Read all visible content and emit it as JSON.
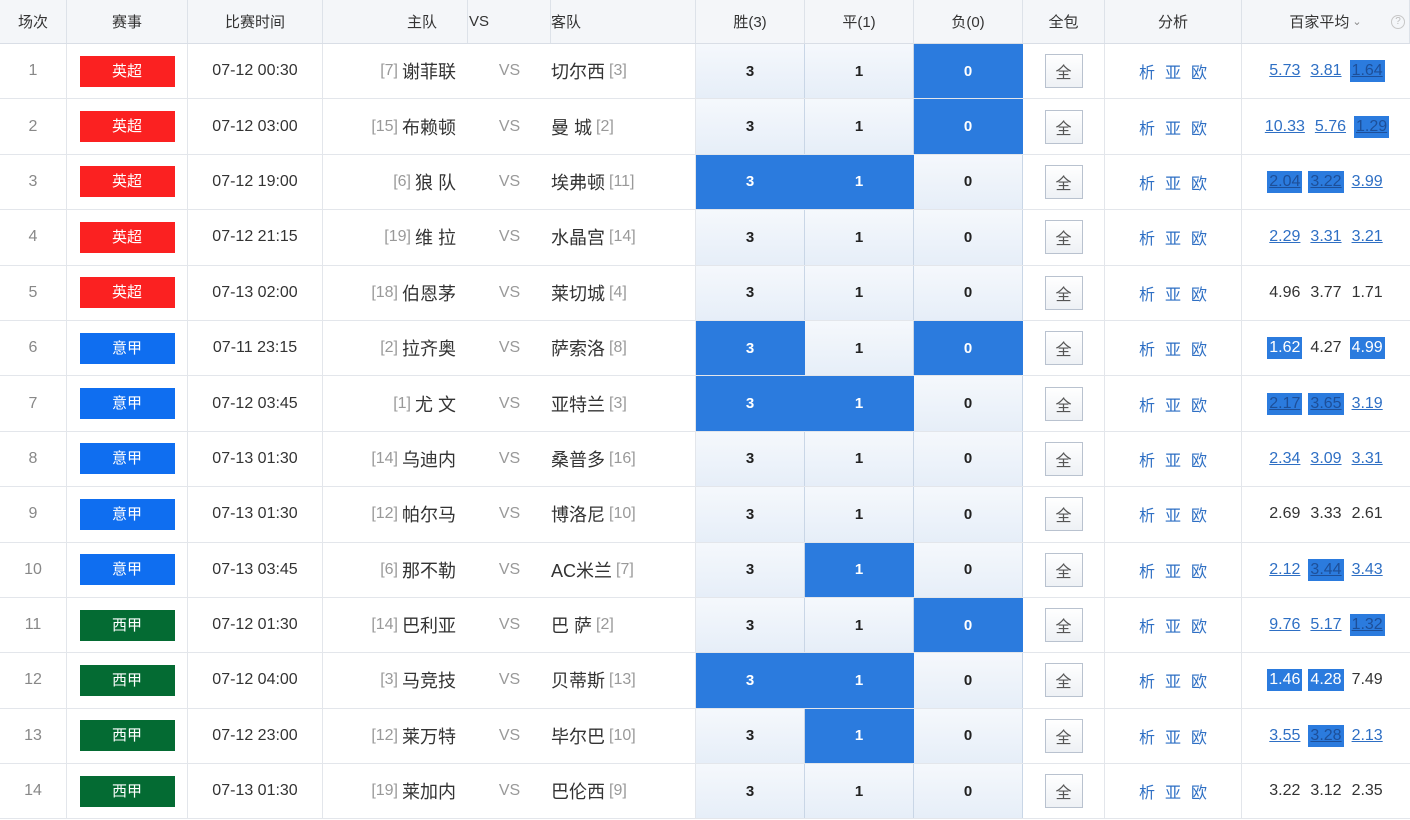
{
  "headers": {
    "idx": "场次",
    "league": "赛事",
    "time": "比赛时间",
    "home": "主队",
    "vs": "VS",
    "away": "客队",
    "win": "胜(3)",
    "draw": "平(1)",
    "loss": "负(0)",
    "all": "全包",
    "analysis": "分析",
    "avg": "百家平均"
  },
  "colors": {
    "epl": "#fb2121",
    "seriea": "#0f6ef0",
    "laliga": "#046b33",
    "selected": "#2b7bde",
    "link": "#2e6fc4"
  },
  "icons": {
    "sort": "chevron-down-icon",
    "help": "question-icon"
  },
  "labels": {
    "all_btn": "全",
    "ana1": "析",
    "ana2": "亚",
    "ana3": "欧"
  },
  "rows": [
    {
      "idx": "1",
      "league": "英超",
      "color": "#fb2121",
      "time": "07-12 00:30",
      "home_rank": "[7]",
      "home": "谢菲联",
      "vs": "VS",
      "away": "切尔西",
      "away_rank": "[3]",
      "win": "3",
      "draw": "1",
      "loss": "0",
      "sel": [
        false,
        false,
        true
      ],
      "odds": [
        {
          "v": "5.73",
          "link": true,
          "hl": false
        },
        {
          "v": "3.81",
          "link": true,
          "hl": false
        },
        {
          "v": "1.64",
          "link": true,
          "hl": true
        }
      ]
    },
    {
      "idx": "2",
      "league": "英超",
      "color": "#fb2121",
      "time": "07-12 03:00",
      "home_rank": "[15]",
      "home": "布赖顿",
      "vs": "VS",
      "away": "曼 城",
      "away_rank": "[2]",
      "win": "3",
      "draw": "1",
      "loss": "0",
      "sel": [
        false,
        false,
        true
      ],
      "odds": [
        {
          "v": "10.33",
          "link": true,
          "hl": false
        },
        {
          "v": "5.76",
          "link": true,
          "hl": false
        },
        {
          "v": "1.29",
          "link": true,
          "hl": true
        }
      ]
    },
    {
      "idx": "3",
      "league": "英超",
      "color": "#fb2121",
      "time": "07-12 19:00",
      "home_rank": "[6]",
      "home": "狼 队",
      "vs": "VS",
      "away": "埃弗顿",
      "away_rank": "[11]",
      "win": "3",
      "draw": "1",
      "loss": "0",
      "sel": [
        true,
        true,
        false
      ],
      "odds": [
        {
          "v": "2.04",
          "link": true,
          "hl": true
        },
        {
          "v": "3.22",
          "link": true,
          "hl": true
        },
        {
          "v": "3.99",
          "link": true,
          "hl": false
        }
      ]
    },
    {
      "idx": "4",
      "league": "英超",
      "color": "#fb2121",
      "time": "07-12 21:15",
      "home_rank": "[19]",
      "home": "维 拉",
      "vs": "VS",
      "away": "水晶宫",
      "away_rank": "[14]",
      "win": "3",
      "draw": "1",
      "loss": "0",
      "sel": [
        false,
        false,
        false
      ],
      "odds": [
        {
          "v": "2.29",
          "link": true,
          "hl": false
        },
        {
          "v": "3.31",
          "link": true,
          "hl": false
        },
        {
          "v": "3.21",
          "link": true,
          "hl": false
        }
      ]
    },
    {
      "idx": "5",
      "league": "英超",
      "color": "#fb2121",
      "time": "07-13 02:00",
      "home_rank": "[18]",
      "home": "伯恩茅",
      "vs": "VS",
      "away": "莱切城",
      "away_rank": "[4]",
      "win": "3",
      "draw": "1",
      "loss": "0",
      "sel": [
        false,
        false,
        false
      ],
      "odds": [
        {
          "v": "4.96",
          "link": false,
          "hl": false
        },
        {
          "v": "3.77",
          "link": false,
          "hl": false
        },
        {
          "v": "1.71",
          "link": false,
          "hl": false
        }
      ]
    },
    {
      "idx": "6",
      "league": "意甲",
      "color": "#0f6ef0",
      "time": "07-11 23:15",
      "home_rank": "[2]",
      "home": "拉齐奥",
      "vs": "VS",
      "away": "萨索洛",
      "away_rank": "[8]",
      "win": "3",
      "draw": "1",
      "loss": "0",
      "sel": [
        true,
        false,
        true
      ],
      "odds": [
        {
          "v": "1.62",
          "link": false,
          "hl": true
        },
        {
          "v": "4.27",
          "link": false,
          "hl": false
        },
        {
          "v": "4.99",
          "link": false,
          "hl": true
        }
      ]
    },
    {
      "idx": "7",
      "league": "意甲",
      "color": "#0f6ef0",
      "time": "07-12 03:45",
      "home_rank": "[1]",
      "home": "尤 文",
      "vs": "VS",
      "away": "亚特兰",
      "away_rank": "[3]",
      "win": "3",
      "draw": "1",
      "loss": "0",
      "sel": [
        true,
        true,
        false
      ],
      "odds": [
        {
          "v": "2.17",
          "link": true,
          "hl": true
        },
        {
          "v": "3.65",
          "link": true,
          "hl": true
        },
        {
          "v": "3.19",
          "link": true,
          "hl": false
        }
      ]
    },
    {
      "idx": "8",
      "league": "意甲",
      "color": "#0f6ef0",
      "time": "07-13 01:30",
      "home_rank": "[14]",
      "home": "乌迪内",
      "vs": "VS",
      "away": "桑普多",
      "away_rank": "[16]",
      "win": "3",
      "draw": "1",
      "loss": "0",
      "sel": [
        false,
        false,
        false
      ],
      "odds": [
        {
          "v": "2.34",
          "link": true,
          "hl": false
        },
        {
          "v": "3.09",
          "link": true,
          "hl": false
        },
        {
          "v": "3.31",
          "link": true,
          "hl": false
        }
      ]
    },
    {
      "idx": "9",
      "league": "意甲",
      "color": "#0f6ef0",
      "time": "07-13 01:30",
      "home_rank": "[12]",
      "home": "帕尔马",
      "vs": "VS",
      "away": "博洛尼",
      "away_rank": "[10]",
      "win": "3",
      "draw": "1",
      "loss": "0",
      "sel": [
        false,
        false,
        false
      ],
      "odds": [
        {
          "v": "2.69",
          "link": false,
          "hl": false
        },
        {
          "v": "3.33",
          "link": false,
          "hl": false
        },
        {
          "v": "2.61",
          "link": false,
          "hl": false
        }
      ]
    },
    {
      "idx": "10",
      "league": "意甲",
      "color": "#0f6ef0",
      "time": "07-13 03:45",
      "home_rank": "[6]",
      "home": "那不勒",
      "vs": "VS",
      "away": "AC米兰",
      "away_rank": "[7]",
      "win": "3",
      "draw": "1",
      "loss": "0",
      "sel": [
        false,
        true,
        false
      ],
      "odds": [
        {
          "v": "2.12",
          "link": true,
          "hl": false
        },
        {
          "v": "3.44",
          "link": true,
          "hl": true
        },
        {
          "v": "3.43",
          "link": true,
          "hl": false
        }
      ]
    },
    {
      "idx": "11",
      "league": "西甲",
      "color": "#046b33",
      "time": "07-12 01:30",
      "home_rank": "[14]",
      "home": "巴利亚",
      "vs": "VS",
      "away": "巴 萨",
      "away_rank": "[2]",
      "win": "3",
      "draw": "1",
      "loss": "0",
      "sel": [
        false,
        false,
        true
      ],
      "odds": [
        {
          "v": "9.76",
          "link": true,
          "hl": false
        },
        {
          "v": "5.17",
          "link": true,
          "hl": false
        },
        {
          "v": "1.32",
          "link": true,
          "hl": true
        }
      ]
    },
    {
      "idx": "12",
      "league": "西甲",
      "color": "#046b33",
      "time": "07-12 04:00",
      "home_rank": "[3]",
      "home": "马竞技",
      "vs": "VS",
      "away": "贝蒂斯",
      "away_rank": "[13]",
      "win": "3",
      "draw": "1",
      "loss": "0",
      "sel": [
        true,
        true,
        false
      ],
      "odds": [
        {
          "v": "1.46",
          "link": false,
          "hl": true
        },
        {
          "v": "4.28",
          "link": false,
          "hl": true
        },
        {
          "v": "7.49",
          "link": false,
          "hl": false
        }
      ]
    },
    {
      "idx": "13",
      "league": "西甲",
      "color": "#046b33",
      "time": "07-12 23:00",
      "home_rank": "[12]",
      "home": "莱万特",
      "vs": "VS",
      "away": "毕尔巴",
      "away_rank": "[10]",
      "win": "3",
      "draw": "1",
      "loss": "0",
      "sel": [
        false,
        true,
        false
      ],
      "odds": [
        {
          "v": "3.55",
          "link": true,
          "hl": false
        },
        {
          "v": "3.28",
          "link": true,
          "hl": true
        },
        {
          "v": "2.13",
          "link": true,
          "hl": false
        }
      ]
    },
    {
      "idx": "14",
      "league": "西甲",
      "color": "#046b33",
      "time": "07-13 01:30",
      "home_rank": "[19]",
      "home": "莱加内",
      "vs": "VS",
      "away": "巴伦西",
      "away_rank": "[9]",
      "win": "3",
      "draw": "1",
      "loss": "0",
      "sel": [
        false,
        false,
        false
      ],
      "odds": [
        {
          "v": "3.22",
          "link": false,
          "hl": false
        },
        {
          "v": "3.12",
          "link": false,
          "hl": false
        },
        {
          "v": "2.35",
          "link": false,
          "hl": false
        }
      ]
    }
  ]
}
